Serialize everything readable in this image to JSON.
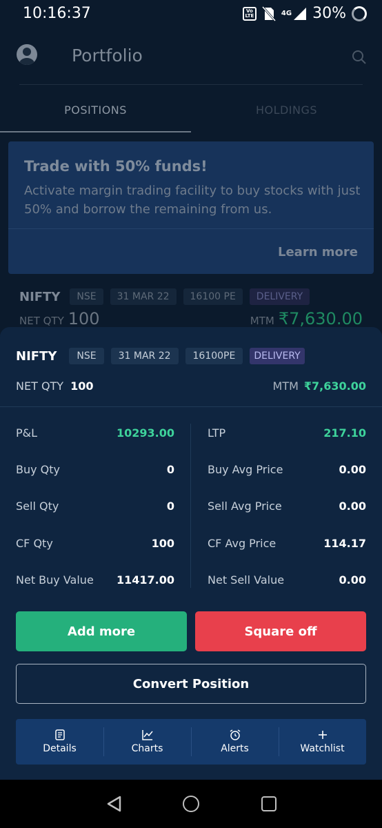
{
  "status_bar": {
    "time": "10:16:37",
    "battery": "30%",
    "volte": "Vo LTE",
    "network": "4G"
  },
  "header": {
    "title": "Portfolio"
  },
  "tabs": [
    {
      "label": "POSITIONS"
    },
    {
      "label": "HOLDINGS"
    }
  ],
  "promo": {
    "title": "Trade with 50% funds!",
    "text": "Activate margin trading facility to buy stocks with just 50% and borrow the remaining from us.",
    "link": "Learn more"
  },
  "background_row": {
    "symbol": "NIFTY",
    "exchange": "NSE",
    "expiry": "31 MAR 22",
    "strike": "16100 PE",
    "product": "DELIVERY",
    "net_qty_label": "NET QTY",
    "net_qty": "100",
    "mtm_label": "MTM",
    "mtm": "₹7,630.00"
  },
  "sheet": {
    "symbol": "NIFTY",
    "exchange": "NSE",
    "expiry": "31 MAR 22",
    "strike": "16100PE",
    "product": "DELIVERY",
    "net_qty_label": "NET QTY",
    "net_qty": "100",
    "mtm_label": "MTM",
    "mtm": "₹7,630.00",
    "left_stats": [
      {
        "label": "P&L",
        "value": "10293.00"
      },
      {
        "label": "Buy Qty",
        "value": "0"
      },
      {
        "label": "Sell Qty",
        "value": "0"
      },
      {
        "label": "CF Qty",
        "value": "100"
      },
      {
        "label": "Net Buy Value",
        "value": "11417.00"
      }
    ],
    "right_stats": [
      {
        "label": "LTP",
        "value": "217.10"
      },
      {
        "label": "Buy Avg Price",
        "value": "0.00"
      },
      {
        "label": "Sell Avg Price",
        "value": "0.00"
      },
      {
        "label": "CF Avg Price",
        "value": "114.17"
      },
      {
        "label": "Net Sell Value",
        "value": "0.00"
      }
    ],
    "buttons": {
      "add_more": "Add more",
      "square_off": "Square off",
      "convert": "Convert Position"
    },
    "actions": [
      {
        "label": "Details",
        "icon": "document-icon"
      },
      {
        "label": "Charts",
        "icon": "chart-icon"
      },
      {
        "label": "Alerts",
        "icon": "alarm-clock-icon"
      },
      {
        "label": "Watchlist",
        "icon": "plus-icon"
      }
    ]
  },
  "colors": {
    "accent_green": "#3ed39b",
    "add_button": "#25b07c",
    "square_off_button": "#e8404c",
    "sheet_bg": "#0f2540"
  }
}
